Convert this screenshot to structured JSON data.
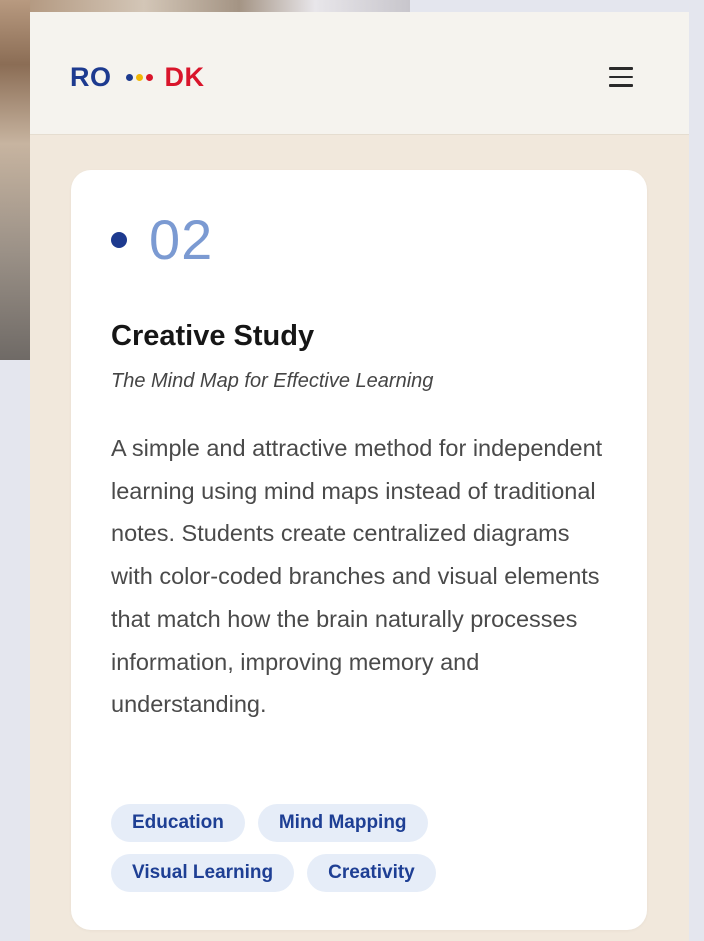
{
  "header": {
    "logo_left": "RO",
    "logo_right": "DK",
    "logo_dot_colors": [
      "#1d3a8f",
      "#f2b705",
      "#d9152b"
    ],
    "menu_icon": "hamburger-menu-icon"
  },
  "card": {
    "number": "02",
    "title": "Creative Study",
    "subtitle": "The Mind Map for Effective Learning",
    "description": "A simple and attractive method for independent learning using mind maps instead of traditional notes. Students create centralized diagrams with color-coded branches and visual elements that match how the brain naturally processes information, improving memory and understanding.",
    "tags": [
      "Education",
      "Mind Mapping",
      "Visual Learning",
      "Creativity"
    ]
  },
  "colors": {
    "accent_blue": "#1d3a8f",
    "number_blue": "#7b9ad2",
    "logo_red": "#d9152b",
    "logo_yellow": "#f2b705",
    "tag_bg": "#e6edf8",
    "tag_text": "#1e3f94"
  }
}
